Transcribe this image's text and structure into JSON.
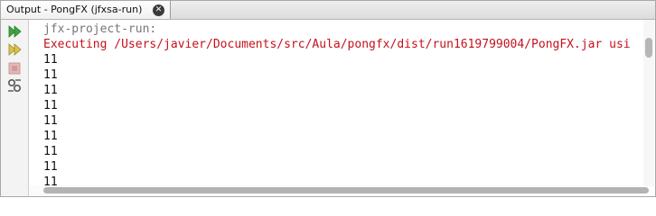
{
  "tab": {
    "title": "Output - PongFX (jfxsa-run)",
    "close_icon": "close-icon"
  },
  "toolbar": {
    "buttons": [
      {
        "name": "rerun-icon",
        "color": "#3ea33e"
      },
      {
        "name": "rerun-with-params-icon",
        "color": "#c9b33a"
      },
      {
        "name": "stop-icon",
        "color": "#d9a0a0"
      },
      {
        "name": "settings-icon",
        "color": "#666666"
      }
    ]
  },
  "output": {
    "lines": [
      {
        "text": "jfx-project-run:",
        "kind": "gray"
      },
      {
        "text": "Executing /Users/javier/Documents/src/Aula/pongfx/dist/run1619799004/PongFX.jar usi",
        "kind": "red"
      },
      {
        "text": "11",
        "kind": "black"
      },
      {
        "text": "11",
        "kind": "black"
      },
      {
        "text": "11",
        "kind": "black"
      },
      {
        "text": "11",
        "kind": "black"
      },
      {
        "text": "11",
        "kind": "black"
      },
      {
        "text": "11",
        "kind": "black"
      },
      {
        "text": "11",
        "kind": "black"
      },
      {
        "text": "11",
        "kind": "black"
      },
      {
        "text": "11",
        "kind": "black"
      }
    ]
  },
  "colors": {
    "command_text": "#767676",
    "error_text": "#c4121b",
    "output_text": "#111111"
  }
}
